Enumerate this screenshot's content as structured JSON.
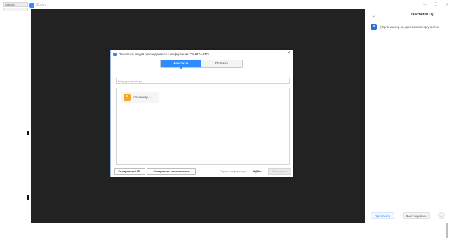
{
  "taskbar": {
    "label": "Speaker"
  },
  "window": {
    "title": "Zoom",
    "controls": {
      "minimize": "—",
      "maximize": "☐",
      "close": "✕"
    }
  },
  "participants_panel": {
    "collapse": "⌄",
    "title": "Участники (1)",
    "participant": {
      "initial": "И",
      "name": "(Организатор, я, идентификатор участни"
    },
    "buttons": {
      "invite": "Пригласить",
      "mute_all": "Выкл звук всех",
      "more": "..."
    }
  },
  "invite_dialog": {
    "title": "Пригласить людей присоединиться к конференции 735-9474-6375",
    "close": "✕",
    "tabs": [
      {
        "label": "Контакты",
        "active": true
      },
      {
        "label": "По почте",
        "active": false
      }
    ],
    "filter_placeholder": "Ввод для фильтра",
    "contact": {
      "initial": "А",
      "name": "Александр ..."
    },
    "copy_url": "Копировать URL",
    "copy_invitation": "Копировать приглашение",
    "password_label": "Пароль конференции:",
    "password_value": "9qBkn",
    "invite_button": "Пригласить"
  },
  "colors": {
    "accent": "#2d8cff",
    "video_bg": "#222222",
    "contact_avatar": "#f5a623"
  }
}
